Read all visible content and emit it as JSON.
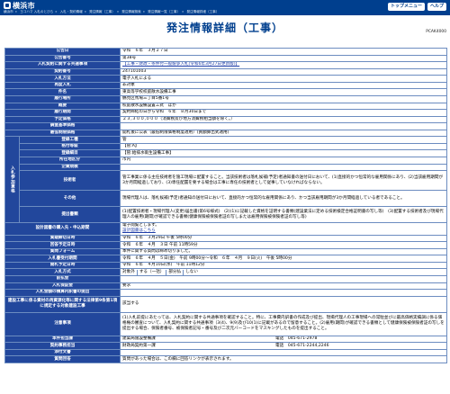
{
  "header": {
    "logo": "横浜市",
    "top_links": [
      "トップメニュー",
      "ヘルプ"
    ],
    "breadcrumbs": [
      "横浜市",
      "ヨコハマ 入札のとびら",
      "入札・契約情報",
      "発注情報（工事）",
      "発注情報検索",
      "発注情報一覧（工事）",
      "発注情報詳細（工事）"
    ]
  },
  "page": {
    "title": "発注情報詳細（工事）",
    "id": "PCAK4000"
  },
  "rows": {
    "koukoku_bi": {
      "label": "公告日",
      "value": "令和　６年　３月２７日"
    },
    "koukoku_no": {
      "label": "公告番号",
      "value": "第38号"
    },
    "joken": {
      "label": "入札契約に関する共通事項",
      "value": "【工事・財政・条件付一般競争入札(令和6年3月27日更新版)】"
    },
    "keiyaku_no": {
      "label": "契約番号",
      "value": "247101003"
    },
    "hoshiki": {
      "label": "入札方法",
      "value": "電子入札による"
    },
    "kubun": {
      "label": "再度入札",
      "value": "非対象"
    },
    "kenmei": {
      "label": "件名",
      "value": "東高等学校校庭散水設備工事"
    },
    "basho": {
      "label": "履行場所",
      "value": "鶴見区馬場三丁目5番1号"
    },
    "gaiyo": {
      "label": "概要",
      "value": "校庭散水設備設置工式　ほか"
    },
    "kikan": {
      "label": "履行期間",
      "value": "契約締結の日から令和　６年　８月30日まで"
    },
    "yotei_kakaku": {
      "label": "予定価格",
      "value": "２３,３００,０００（消費税及び地方消費税相当額を除く。）"
    },
    "chosa": {
      "label": "調査基準価格",
      "value": ""
    },
    "saitei": {
      "label": "最低制限価格",
      "value": "開札後に公表（最低制限価格制度適用）(貢額算出式適用)"
    },
    "shikaku_group": "入札参加資格",
    "touroku_koushu": {
      "label": "登録工種",
      "value": "管"
    },
    "kakuzuke": {
      "label": "格付等級",
      "value": "【管:A】"
    },
    "touroku_kubun": {
      "label": "登録細目",
      "value": "【管:給排水衛生設備工事】"
    },
    "shozaichi": {
      "label": "所在地区分",
      "value": "市内"
    },
    "kigyou": {
      "label": "企業規模",
      "value": ""
    },
    "gijutsusha": {
      "label": "技術者",
      "value": "管工事業に係る主任技術者を施工現場に配置すること。当該技術者は落札候補(予定)者通知書の送付日において、(1)直接的かつ恒常的な雇用関係にあり、(2)当該雇用期間が3か月間経過しており、(3)専任配置を要する場合は工事に専任の技術者として従事していなければならない。"
    },
    "sonota": {
      "label": "その他",
      "value": "現場代理人は、落札候補(予定)者通知の送付日において、直接的かつ恒常的な雇用関係にあり、かつ当該雇用期間が3か月間経過している者であること。"
    },
    "teishutsu": {
      "label": "提出書類",
      "value": "(1)配置技術者・現場代理人(変更)届出書(第6号様式)　(2)(1)に記載した資格を証明する書類(建設業法に定める技術検定合格証明書の写し等)　(3)配置する技術者及び現場代理人の雇用(期間)が確認できる書類(健康保険被保険者証の写しまたは雇用保険被保険者証の写し等)"
    },
    "sekkei": {
      "label": "設計図書の購入先・申込期間",
      "value": "電子閲覧とします。"
    },
    "sekkei_link": "設計図書はこちら",
    "shitsumon": {
      "label": "質疑締切日時",
      "value": "令和　６年　３月29日 午後 5時00分"
    },
    "kaitou": {
      "label": "回答予定日時",
      "value": "令和　６年　４月　３日 午前 11時59分"
    },
    "keishiki": {
      "label": "質問フォーム",
      "value": "本件に関する質問は締め切りました。"
    },
    "nyuusatsu_kikan": {
      "label": "入札書受付期間",
      "value": "令和　６年　４月　５日(金)　午前 9時00分〜令和　６年　４月　９日(火)　午後 5時00分"
    },
    "kaisatsu": {
      "label": "開札予定日時",
      "value": "令和　６年　４月10日(水)　午前 11時12分"
    },
    "yoyaku_label": "入札方式",
    "yoyaku_parts": [
      "対象外",
      "する（一括）",
      "部分払",
      "しない"
    ],
    "hoshou": {
      "label": "前払金",
      "value": ""
    },
    "kaiketsu": {
      "label": "入札保証金",
      "value": "要求"
    },
    "shiharai": {
      "label": "入札金額の積算内訳書の提出",
      "value": ""
    },
    "kensetsu": {
      "label": "建設工事に係る資材の再資源化等に関する法律第9条第1項に規定する対象建設工事",
      "value": "該当する"
    },
    "chuui": {
      "label": "注意事項",
      "value": "(1)入札前提にあたっては、入札契約に関する共通事項を確認すること。特に、工事費内訳書の作成及び提出、現場代理人の工事現場への常駐並びに最高価格実績調に係る価格権の審査について、入札契約に関する共通事項（3(4)、9(9)及び10(1)に記載があるので留意すること。(2)雇用(期間)が確認できる書類として健康保険被保険者証の写しを提出する場合、保険者番号、被保険者記号・番号及び二次元バーコードをマスキングしたものを提出すること。"
    },
    "tantou": {
      "label": "本件担当課",
      "value": "建築局施設整備課",
      "tel_label": "電話",
      "tel": "045-671-2978"
    },
    "keiyaku_tantou": {
      "label": "契約事務担当",
      "value": "財政局契約第一課",
      "tel_label": "電話",
      "tel": "045-671-2244,2246"
    },
    "jouhou": {
      "label": "添付文書",
      "value": ""
    },
    "toiawase": {
      "label": "質問回答",
      "value": "質問があった場合は、この欄に回答リンクが表示されます。"
    }
  },
  "colors": {
    "header_blue": "#003f8e",
    "label_blue": "#22479c",
    "title_blue": "#003f8e",
    "link": "#1f3ea8"
  }
}
